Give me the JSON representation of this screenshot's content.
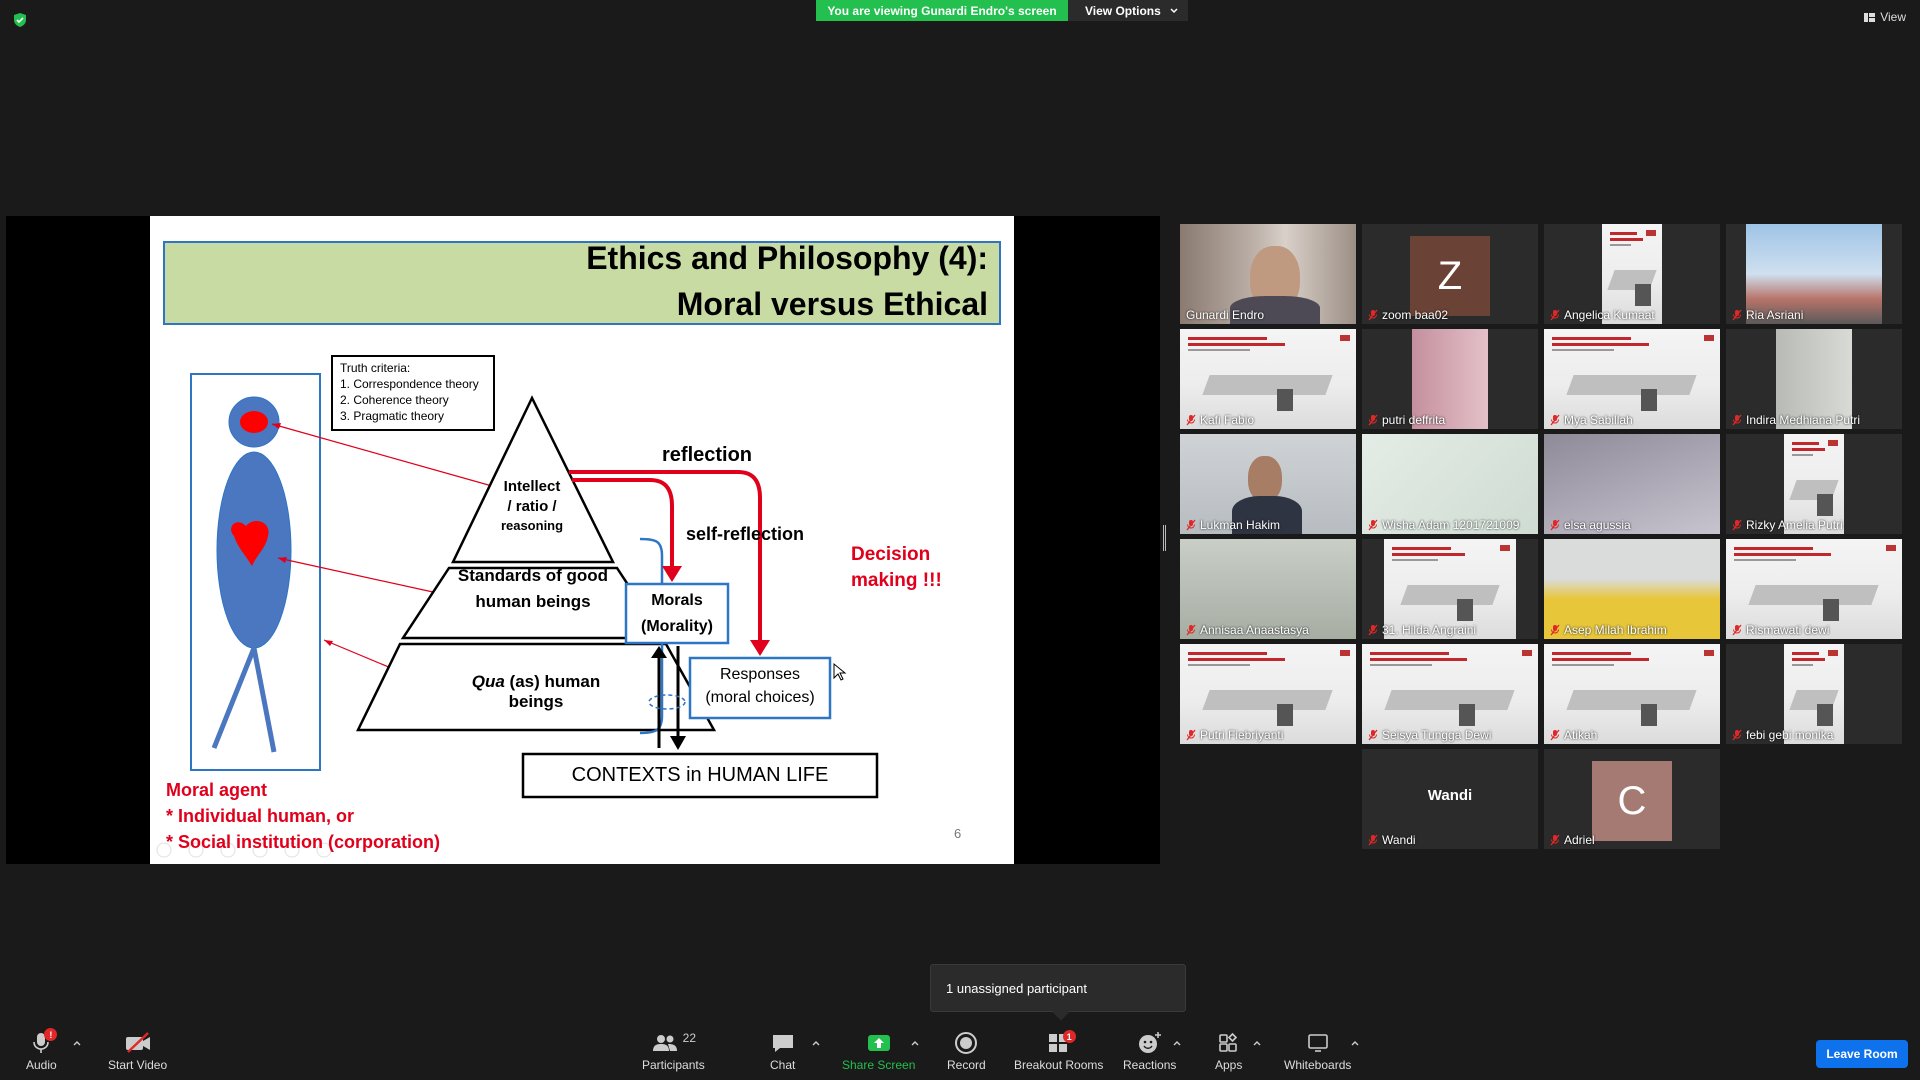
{
  "top": {
    "viewing_banner": "You are viewing Gunardi Endro's screen",
    "view_options": "View Options",
    "view": "View"
  },
  "slide": {
    "title_line1": "Ethics and Philosophy (4):",
    "title_line2": "Moral versus Ethical",
    "truth_criteria": {
      "heading": "Truth criteria:",
      "items": [
        "1. Correspondence theory",
        "2. Coherence theory",
        "3. Pragmatic theory"
      ]
    },
    "pyramid_top": [
      "Intellect",
      "/ ratio /",
      "reasoning"
    ],
    "pyramid_mid": [
      "Standards of good",
      "human beings"
    ],
    "pyramid_bottom_italic": "Qua",
    "pyramid_bottom_rest": "(as) human beings",
    "reflection": "reflection",
    "self_reflection": "self-reflection",
    "decision": [
      "Decision",
      "making !!!"
    ],
    "morals": [
      "Morals",
      "(Morality)"
    ],
    "responses": [
      "Responses",
      "(moral choices)"
    ],
    "contexts": "CONTEXTS in HUMAN LIFE",
    "moral_agent": [
      "Moral agent",
      "* Individual human, or",
      "* Social institution (corporation)"
    ],
    "page_number": "6",
    "colors": {
      "title_band": "#c7dba2",
      "blue": "#2e75c4",
      "red": "#e0001b",
      "figure": "#4a77c0"
    }
  },
  "participants": [
    {
      "name": "Gunardi Endro",
      "muted": false,
      "active": true,
      "kind": "video"
    },
    {
      "name": "zoom baa02",
      "muted": true,
      "kind": "avatar",
      "letter": "Z",
      "color": "#6b4236"
    },
    {
      "name": "Angelica Kumaat",
      "muted": true,
      "kind": "slide-narrow"
    },
    {
      "name": "Ria Asriani",
      "muted": true,
      "kind": "sky"
    },
    {
      "name": "Kafi Fabio",
      "muted": true,
      "kind": "slide"
    },
    {
      "name": "putri deffrita",
      "muted": true,
      "kind": "pink"
    },
    {
      "name": "Mya Sabillah",
      "muted": true,
      "kind": "slide"
    },
    {
      "name": "Indira Medhiana Putri",
      "muted": true,
      "kind": "grey"
    },
    {
      "name": "Lukman Hakim",
      "muted": true,
      "kind": "video2"
    },
    {
      "name": "Wisha Adam 1201721009",
      "muted": true,
      "kind": "light"
    },
    {
      "name": "elsa agussia",
      "muted": true,
      "kind": "ceiling"
    },
    {
      "name": "Rizky Amelia Putri",
      "muted": true,
      "kind": "slide-narrow"
    },
    {
      "name": "Annisaa Anaastasya",
      "muted": true,
      "kind": "wall"
    },
    {
      "name": "31. Hilda Angraini",
      "muted": true,
      "kind": "slide-mid"
    },
    {
      "name": "Asep Milah Ibrahim",
      "muted": true,
      "kind": "yellow"
    },
    {
      "name": "Rismawati dewi",
      "muted": true,
      "kind": "slide"
    },
    {
      "name": "Putri Fiebriyanti",
      "muted": true,
      "kind": "slide"
    },
    {
      "name": "Seisya Tungga Dewi",
      "muted": true,
      "kind": "slide"
    },
    {
      "name": "Atikah",
      "muted": true,
      "kind": "slide"
    },
    {
      "name": "febi gebi monika",
      "muted": true,
      "kind": "slide-narrow"
    },
    {
      "name": "Wandi",
      "muted": true,
      "kind": "name-only",
      "center": "Wandi"
    },
    {
      "name": "Adriel",
      "muted": true,
      "kind": "avatar",
      "letter": "C",
      "color": "#a57a72"
    }
  ],
  "popup": {
    "unassigned": "1 unassigned participant"
  },
  "toolbar": {
    "audio": "Audio",
    "audio_badge": "!",
    "start_video": "Start Video",
    "participants": "Participants",
    "participants_count": "22",
    "chat": "Chat",
    "share_screen": "Share Screen",
    "record": "Record",
    "breakout_rooms": "Breakout Rooms",
    "breakout_badge": "1",
    "reactions": "Reactions",
    "apps": "Apps",
    "whiteboards": "Whiteboards",
    "leave_room": "Leave Room"
  }
}
